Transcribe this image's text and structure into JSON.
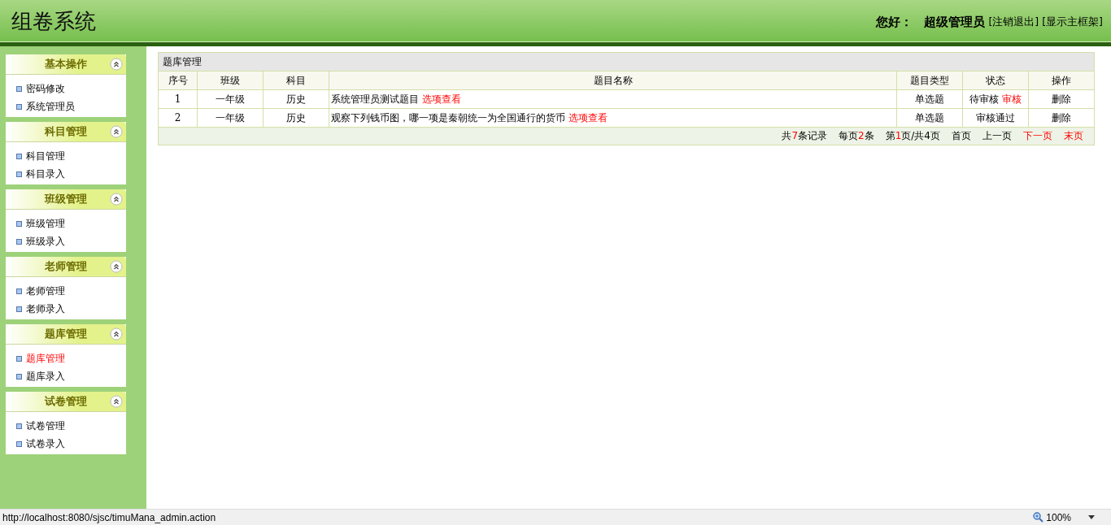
{
  "header": {
    "title": "组卷系统",
    "greeting": "您好：",
    "user": "超级管理员",
    "links": [
      "[注销退出]",
      "[显示主框架]"
    ]
  },
  "sidebar": {
    "groups": [
      {
        "title": "基本操作",
        "expanded": true,
        "items": [
          {
            "label": "密码修改",
            "selected": false
          },
          {
            "label": "系统管理员",
            "selected": false
          }
        ]
      },
      {
        "title": "科目管理",
        "expanded": true,
        "items": [
          {
            "label": "科目管理",
            "selected": false
          },
          {
            "label": "科目录入",
            "selected": false
          }
        ]
      },
      {
        "title": "班级管理",
        "expanded": true,
        "items": [
          {
            "label": "班级管理",
            "selected": false
          },
          {
            "label": "班级录入",
            "selected": false
          }
        ]
      },
      {
        "title": "老师管理",
        "expanded": true,
        "items": [
          {
            "label": "老师管理",
            "selected": false
          },
          {
            "label": "老师录入",
            "selected": false
          }
        ]
      },
      {
        "title": "题库管理",
        "expanded": true,
        "items": [
          {
            "label": "题库管理",
            "selected": true
          },
          {
            "label": "题库录入",
            "selected": false
          }
        ]
      },
      {
        "title": "试卷管理",
        "expanded": true,
        "items": [
          {
            "label": "试卷管理",
            "selected": false
          },
          {
            "label": "试卷录入",
            "selected": false
          }
        ]
      }
    ]
  },
  "table": {
    "title": "题库管理",
    "columns": [
      "序号",
      "班级",
      "科目",
      "题目名称",
      "题目类型",
      "状态",
      "操作"
    ],
    "rows": [
      {
        "no": "1",
        "class": "一年级",
        "subject": "历史",
        "question": "系统管理员测试题目",
        "question_link": "选项查看",
        "type": "单选题",
        "status": "待审核",
        "status_link": "审核",
        "action": "删除"
      },
      {
        "no": "2",
        "class": "一年级",
        "subject": "历史",
        "question": "观察下列钱币图，哪一项是秦朝统一为全国通行的货币",
        "question_link": "选项查看",
        "type": "单选题",
        "status": "审核通过",
        "action": "删除"
      }
    ]
  },
  "pager": [
    {
      "kind": "info",
      "parts": [
        {
          "text": "共",
          "highlight": false
        },
        {
          "text": "7",
          "highlight": true
        },
        {
          "text": "条记录",
          "highlight": false
        }
      ]
    },
    {
      "kind": "info",
      "parts": [
        {
          "text": "每页",
          "highlight": false
        },
        {
          "text": "2",
          "highlight": true
        },
        {
          "text": "条",
          "highlight": false
        }
      ]
    },
    {
      "kind": "info",
      "parts": [
        {
          "text": "第",
          "highlight": false
        },
        {
          "text": "1",
          "highlight": true
        },
        {
          "text": "页/共4页",
          "highlight": false
        }
      ]
    },
    {
      "kind": "link",
      "text": "首页",
      "enabled": false
    },
    {
      "kind": "link",
      "text": "上一页",
      "enabled": false
    },
    {
      "kind": "link",
      "text": "下一页",
      "enabled": true
    },
    {
      "kind": "link",
      "text": "末页",
      "enabled": true
    }
  ],
  "status_bar": {
    "url": "http://localhost:8080/sjsc/timuMana_admin.action",
    "zoom": "100%"
  }
}
